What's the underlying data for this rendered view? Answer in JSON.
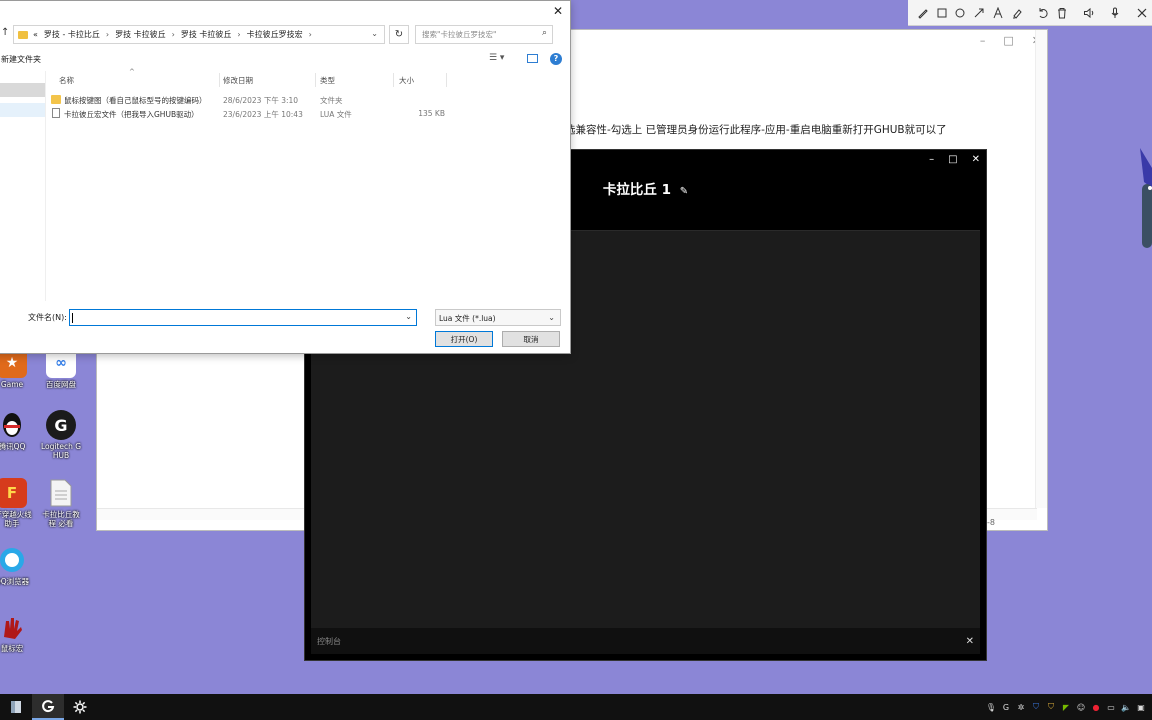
{
  "annotation_toolbar": {
    "tools": [
      {
        "name": "pen-icon",
        "glyph": "✎"
      },
      {
        "name": "rectangle-icon",
        "glyph": "□"
      },
      {
        "name": "circle-icon",
        "glyph": "○"
      },
      {
        "name": "arrow-icon",
        "glyph": "↗"
      },
      {
        "name": "text-icon",
        "glyph": "A"
      },
      {
        "name": "highlighter-icon",
        "glyph": "✐"
      },
      {
        "name": "undo-icon",
        "glyph": "↺"
      },
      {
        "name": "trash-icon",
        "glyph": "🗑"
      },
      {
        "name": "speaker-icon",
        "glyph": "🔈"
      },
      {
        "name": "microphone-icon",
        "glyph": "🎙"
      },
      {
        "name": "close-icon",
        "glyph": "✕"
      }
    ]
  },
  "background_window": {
    "instruction_text": "选兼容性-勾选上 已管理员身份运行此程序-应用-重启电脑重新打开GHUB就可以了",
    "status_text": "-8"
  },
  "desktop_icons": [
    {
      "label": "Game",
      "color": "#e06a1b",
      "glyph": "★"
    },
    {
      "label": "百度网盘",
      "color": "#2f7be8",
      "glyph": "∞"
    },
    {
      "label": "腾讯QQ",
      "color": "#111111",
      "glyph": "🐧"
    },
    {
      "label": "Logitech G HUB",
      "color": "#1b1b1b",
      "glyph": "G"
    },
    {
      "label": "CF穿越火线 助手",
      "color": "#d63b1c",
      "glyph": "F"
    },
    {
      "label": "卡拉比丘教程 必看",
      "color": "#f2f2f2",
      "glyph": "▤"
    },
    {
      "label": "QQ浏览器",
      "color": "#2aa8e8",
      "glyph": "◐"
    },
    {
      "label": "鼠标宏",
      "color": "#b01818",
      "glyph": "✋"
    }
  ],
  "dark_window": {
    "title": "卡拉比丘 1",
    "edit_glyph": "✎",
    "minimize_glyph": "–",
    "maximize_glyph": "□",
    "close_glyph": "✕",
    "console_label": "控制台",
    "console_close_glyph": "✕"
  },
  "file_dialog": {
    "close_glyph": "✕",
    "up_glyph": "↑",
    "breadcrumbs": [
      "«",
      "罗技 - 卡拉比丘",
      "罗技 卡拉彼丘",
      "罗技 卡拉彼丘",
      "卡拉彼丘罗技宏"
    ],
    "breadcrumb_sep": "›",
    "refresh_glyph": "↻",
    "search_placeholder": "搜索\"卡拉彼丘罗技宏\"",
    "search_glyph": "⌕",
    "new_folder_label": "新建文件夹",
    "columns": {
      "name": "名称",
      "date": "修改日期",
      "type": "类型",
      "size": "大小"
    },
    "files": [
      {
        "icon": "folder",
        "name": "鼠标按键图（看自己鼠标型号的按键编码）",
        "date": "28/6/2023 下午 3:10",
        "type": "文件夹",
        "size": ""
      },
      {
        "icon": "doc",
        "name": "卡拉彼丘宏文件（把我导入GHUB驱动）",
        "date": "23/6/2023 上午 10:43",
        "type": "LUA 文件",
        "size": "135 KB"
      }
    ],
    "filename_label": "文件名(N):",
    "filename_value": "",
    "filter_value": "Lua 文件 (*.lua)",
    "open_button": "打开(O)",
    "cancel_button": "取消"
  },
  "taskbar": {
    "items": [
      {
        "name": "file-explorer-icon",
        "glyph": "▮",
        "active": false
      },
      {
        "name": "logitech-ghub-taskbar-icon",
        "glyph": "G",
        "active": true
      },
      {
        "name": "settings-gear-taskbar-icon",
        "glyph": "✲",
        "active": false
      }
    ]
  }
}
